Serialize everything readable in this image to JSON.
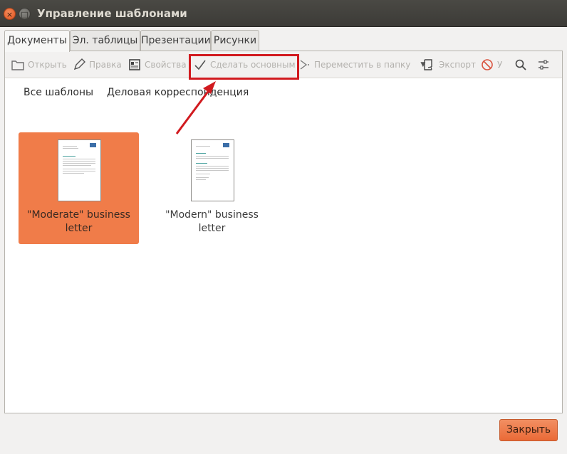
{
  "window": {
    "title": "Управление шаблонами"
  },
  "tabs": [
    {
      "label": "Документы",
      "active": true
    },
    {
      "label": "Эл. таблицы",
      "active": false
    },
    {
      "label": "Презентации",
      "active": false
    },
    {
      "label": "Рисунки",
      "active": false
    }
  ],
  "toolbar": {
    "open": "Открыть",
    "edit": "Правка",
    "properties": "Свойства",
    "set_default": "Сделать основным",
    "move": "Переместить в папку",
    "export": "Экспорт",
    "delete_partial": "У"
  },
  "filters": [
    {
      "label": "Все шаблоны"
    },
    {
      "label": "Деловая корреспонденция"
    }
  ],
  "templates": [
    {
      "label_line1": "\"Moderate\" business",
      "label_line2": "letter",
      "selected": true
    },
    {
      "label_line1": "\"Modern\" business",
      "label_line2": "letter",
      "selected": false
    }
  ],
  "footer": {
    "close_label": "Закрыть"
  },
  "colors": {
    "accent": "#f07c49",
    "highlight": "#d11a1f",
    "titlebar": "#3c3b37"
  },
  "icons": [
    "close-icon",
    "maximize-icon",
    "folder-open-icon",
    "pencil-icon",
    "properties-icon",
    "checkmark-icon",
    "move-arrow-icon",
    "export-icon",
    "delete-icon",
    "search-icon",
    "settings-sliders-icon"
  ]
}
